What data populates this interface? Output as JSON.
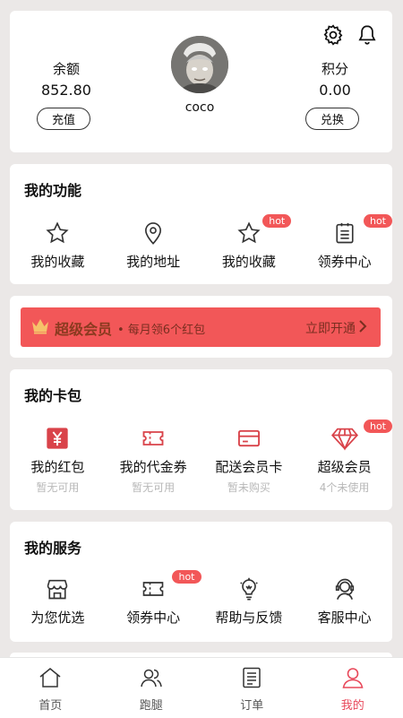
{
  "header": {
    "balance_label": "余额",
    "balance_value": "852.80",
    "recharge_button": "充值",
    "points_label": "积分",
    "points_value": "0.00",
    "exchange_button": "兑换",
    "username": "coco",
    "icons": [
      "gear-icon",
      "bell-icon"
    ]
  },
  "functions": {
    "title": "我的功能",
    "items": [
      {
        "label": "我的收藏",
        "icon": "star-icon",
        "badge": ""
      },
      {
        "label": "我的地址",
        "icon": "location-pin-icon",
        "badge": ""
      },
      {
        "label": "我的收藏",
        "icon": "star-icon",
        "badge": "hot"
      },
      {
        "label": "领券中心",
        "icon": "clipboard-icon",
        "badge": "hot"
      }
    ]
  },
  "vip_banner": {
    "title": "超级会员",
    "subtitle": "• 每月领6个红包",
    "action": "立即开通"
  },
  "wallet": {
    "title": "我的卡包",
    "items": [
      {
        "label": "我的红包",
        "sub": "暂无可用",
        "icon": "red-envelope-icon",
        "badge": ""
      },
      {
        "label": "我的代金券",
        "sub": "暂无可用",
        "icon": "voucher-icon",
        "badge": ""
      },
      {
        "label": "配送会员卡",
        "sub": "暂未购买",
        "icon": "card-icon",
        "badge": ""
      },
      {
        "label": "超级会员",
        "sub": "4个未使用",
        "icon": "diamond-icon",
        "badge": "hot"
      }
    ]
  },
  "services": {
    "title": "我的服务",
    "items": [
      {
        "label": "为您优选",
        "icon": "store-icon",
        "badge": ""
      },
      {
        "label": "领券中心",
        "icon": "ticket-icon",
        "badge": "hot"
      },
      {
        "label": "帮助与反馈",
        "icon": "lightbulb-icon",
        "badge": ""
      },
      {
        "label": "客服中心",
        "icon": "headset-icon",
        "badge": ""
      }
    ]
  },
  "bottom_nav": [
    {
      "label": "首页",
      "icon": "home-icon",
      "active": false
    },
    {
      "label": "跑腿",
      "icon": "users-icon",
      "active": false
    },
    {
      "label": "订单",
      "icon": "order-list-icon",
      "active": false
    },
    {
      "label": "我的",
      "icon": "person-icon",
      "active": true
    }
  ],
  "colors": {
    "accent": "#f25758",
    "background": "#ebe8e7",
    "active_nav": "#e8485a"
  }
}
